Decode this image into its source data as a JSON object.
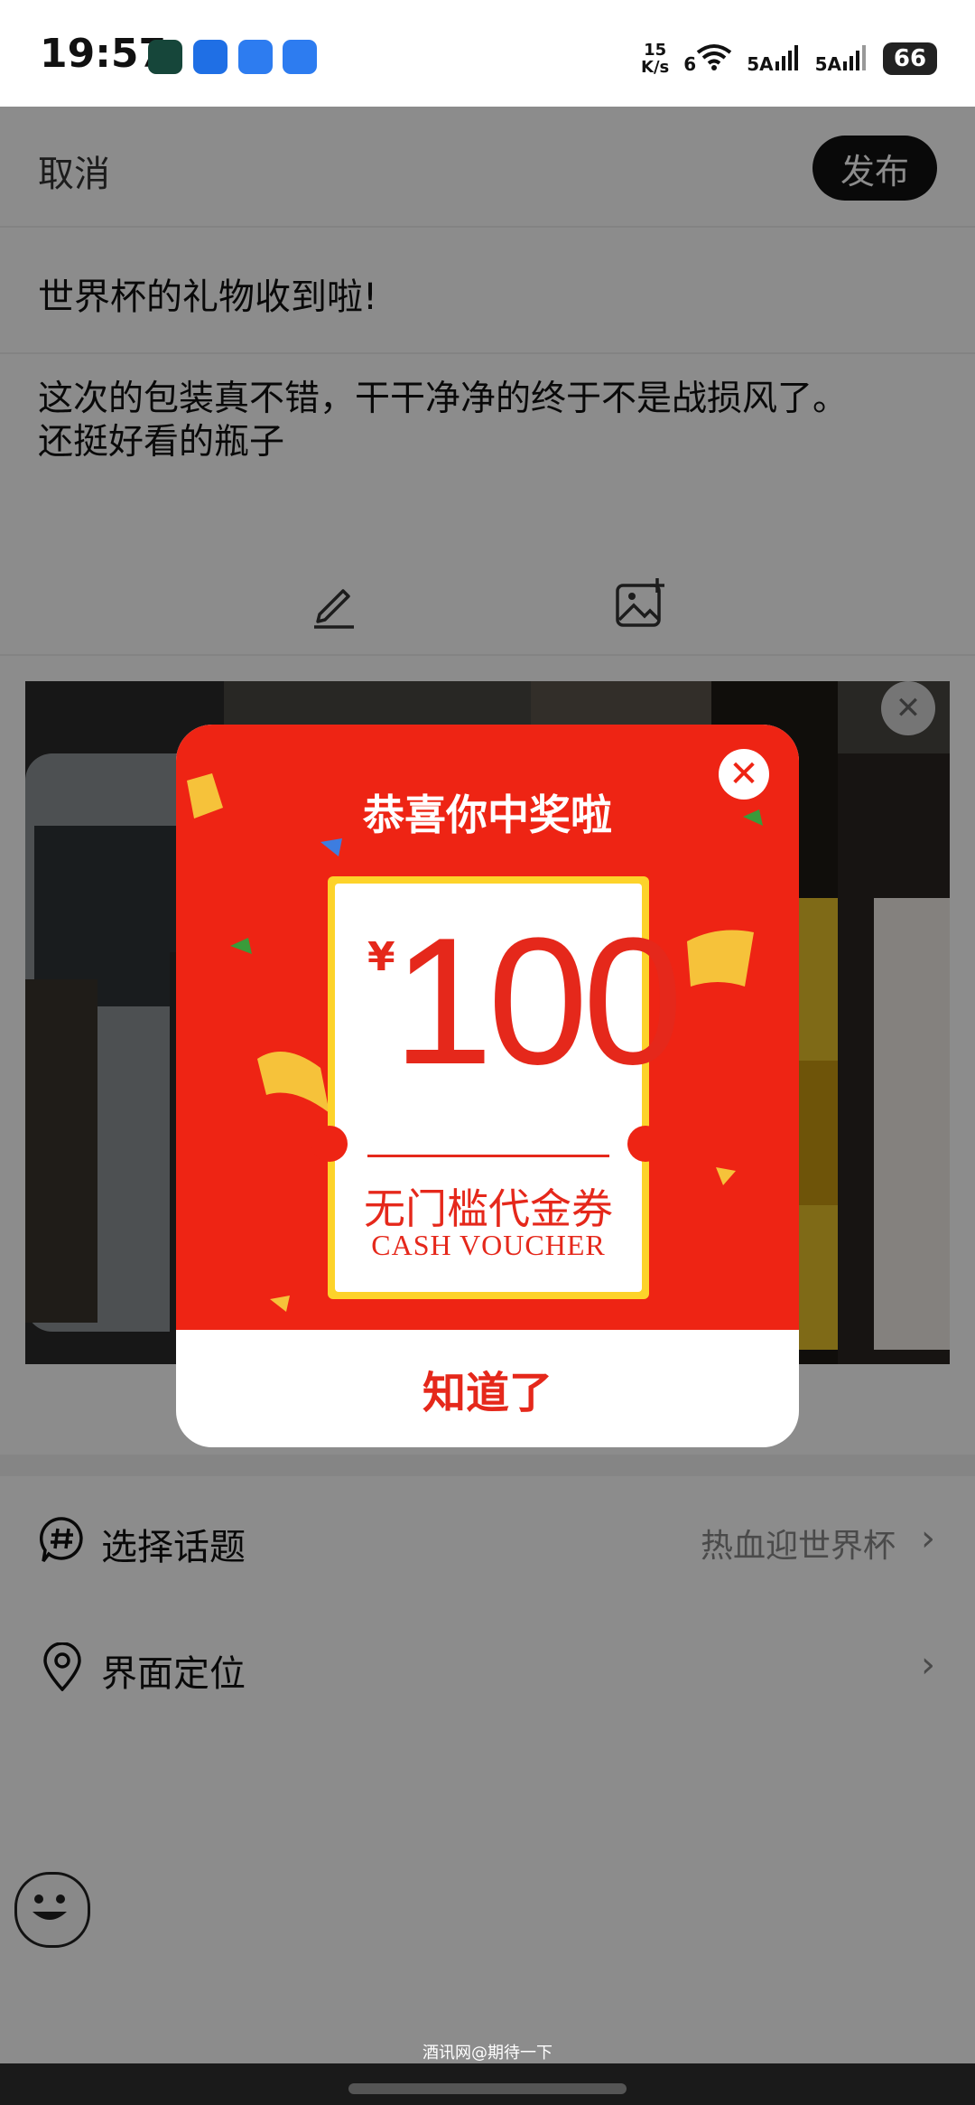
{
  "status_bar": {
    "time": "19:57",
    "net_speed_value": "15",
    "net_speed_unit": "K/s",
    "wifi_label": "6",
    "signal1_label": "5A",
    "signal2_label": "5A",
    "battery": "66"
  },
  "topbar": {
    "cancel": "取消",
    "publish": "发布"
  },
  "post": {
    "title": "世界杯的礼物收到啦!",
    "body_line1": "这次的包装真不错，干干净净的终于不是战损风了。",
    "body_line2": "还挺好看的瓶子"
  },
  "rows": {
    "topic": {
      "label": "选择话题",
      "value": "热血迎世界杯",
      "icon": "hashtag-icon"
    },
    "location": {
      "label": "界面定位",
      "icon": "location-pin-icon"
    }
  },
  "modal": {
    "title": "恭喜你中奖啦",
    "currency": "¥",
    "amount": "100",
    "voucher_type": "无门槛代金券",
    "voucher_en": "CASH VOUCHER",
    "confirm": "知道了",
    "colors": {
      "red": "#ee2414",
      "gold": "#fdd32a"
    }
  },
  "watermark": "酒讯网@期待一下"
}
